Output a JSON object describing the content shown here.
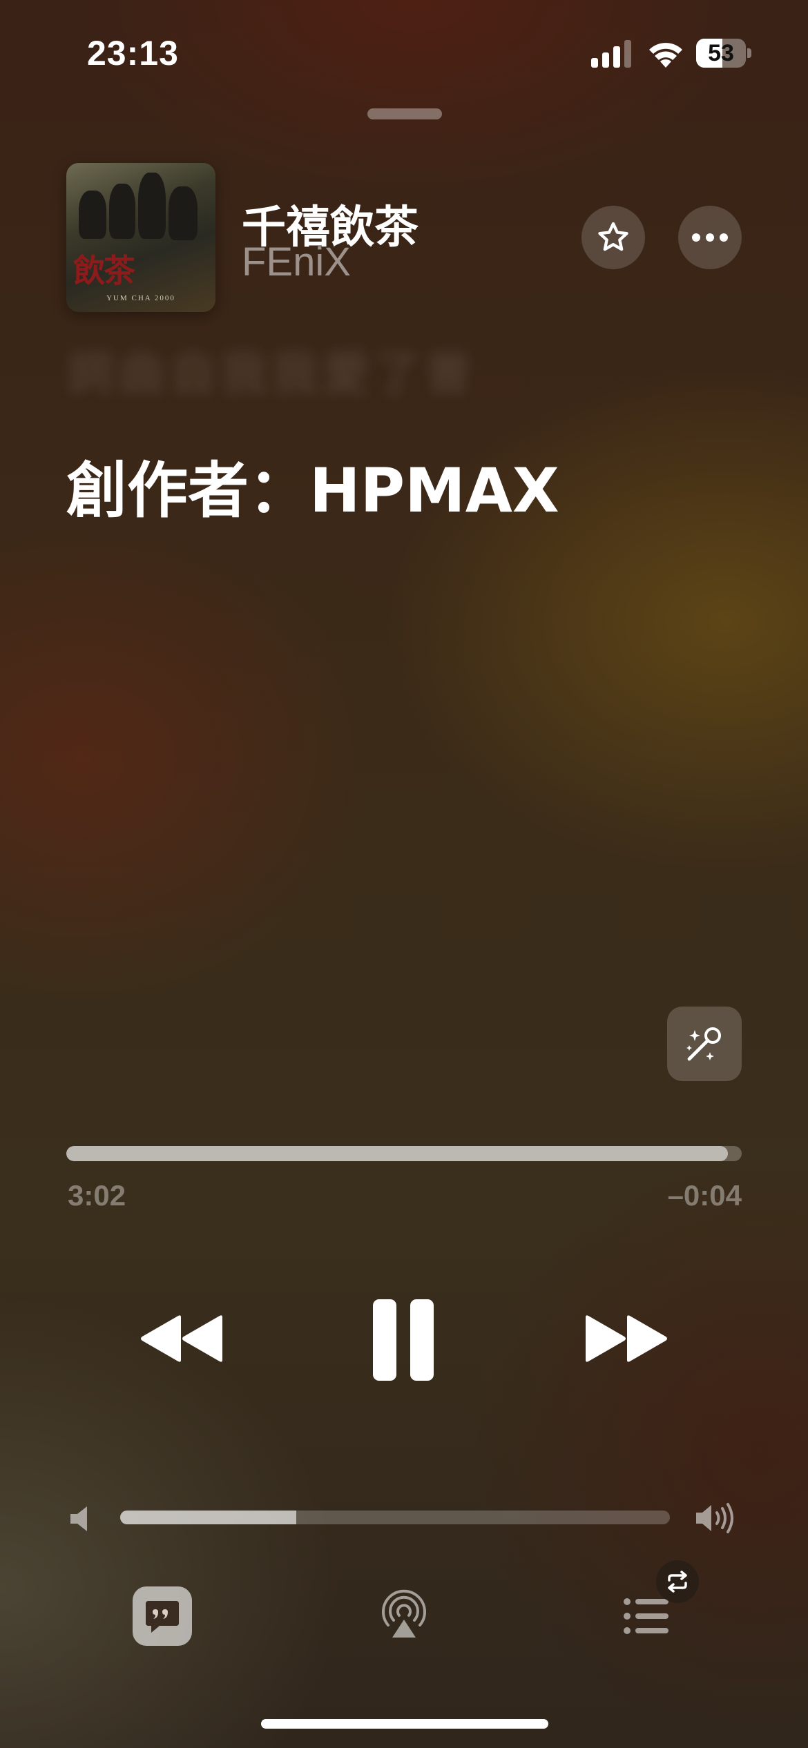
{
  "status_bar": {
    "time": "23:13",
    "battery_level": 53,
    "battery_text": "53",
    "cellular_bars_active": 3
  },
  "now_playing": {
    "title": "千禧飲茶",
    "artist": "FEniX",
    "artwork": {
      "title_text": "飲茶",
      "subtitle_text": "YUM CHA 2000"
    }
  },
  "lyrics": {
    "faded_line": "詞曲自我我愛了曾",
    "current_line": "創作者：HPMAX"
  },
  "playback": {
    "elapsed": "3:02",
    "remaining": "–0:04",
    "progress_fraction": 0.98,
    "volume_fraction": 0.32,
    "state": "playing"
  },
  "icons": {
    "favorite": "star-icon",
    "more": "ellipsis-icon",
    "sing": "microphone-sparkle-icon",
    "rewind": "rewind-icon",
    "pause": "pause-icon",
    "forward": "fast-forward-icon",
    "lyrics": "lyrics-quote-icon",
    "airplay": "airplay-icon",
    "queue": "list-icon",
    "repeat": "repeat-icon"
  }
}
